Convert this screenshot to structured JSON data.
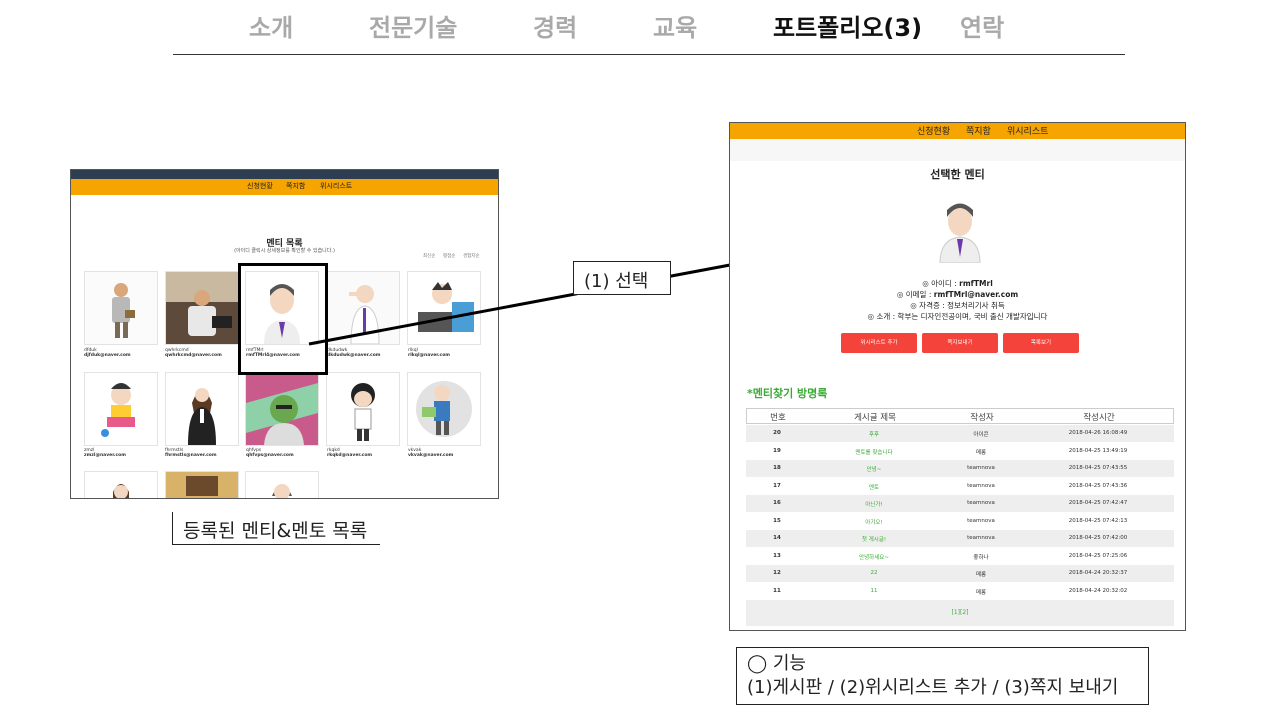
{
  "nav": {
    "items": [
      "소개",
      "전문기술",
      "경력",
      "교육",
      "포트폴리오(3)",
      "연락"
    ],
    "active_index": 4
  },
  "left_shot": {
    "menu": [
      "신청현황",
      "쪽지함",
      "위시리스트"
    ],
    "title": "멘티 목록",
    "subtitle": "(아이디 클릭시 상세정보를 확인할 수 있습니다.)",
    "sort": [
      "최신순",
      "평점순",
      "경험지순"
    ],
    "cards": [
      {
        "id": "dfduk",
        "email": "djfduk@naver.com"
      },
      {
        "id": "qwhrkcmd",
        "email": "qwhrkcmd@naver.com"
      },
      {
        "id": "rmfTMrl",
        "email": "rmfTMrl4@naver.com"
      },
      {
        "id": "dkdudwk",
        "email": "dkdudwk@naver.com"
      },
      {
        "id": "rlkql",
        "email": "rlkql@naver.com"
      },
      {
        "id": "zmzl",
        "email": "zmzl@naver.com"
      },
      {
        "id": "fhrmstls",
        "email": "fhrmstls@naver.com"
      },
      {
        "id": "qhfvps",
        "email": "qhfvps@naver.com"
      },
      {
        "id": "rkqkd",
        "email": "rkqkd@naver.com"
      },
      {
        "id": "vkvak",
        "email": "vkvak@naver.com"
      }
    ]
  },
  "left_caption": "등록된 멘티&멘토 목록",
  "annotation": "(1) 선택",
  "right_shot": {
    "menu": [
      "신청현황",
      "쪽지함",
      "위시리스트"
    ],
    "title": "선택한 멘티",
    "info": {
      "id_label": "◎ 아이디 : ",
      "id_value": "rmfTMrl",
      "email_label": "◎ 이메일 : ",
      "email_value": "rmfTMrl@naver.com",
      "cert": "◎ 자격증 : 정보처리기사 취득",
      "intro": "◎ 소개 : 학부는 디자인전공이며, 국비 출신 개발자입니다"
    },
    "buttons": [
      "위시리스트 추가",
      "쪽지보내기",
      "목록보기"
    ],
    "guestbook_title": "*멘티찾기 방명록",
    "table": {
      "headers": [
        "번호",
        "게시글 제목",
        "작성자",
        "작성시간"
      ],
      "rows": [
        {
          "no": "20",
          "title": "후후",
          "writer": "아이콘",
          "time": "2018-04-26 16:08:49"
        },
        {
          "no": "19",
          "title": "멘토를 찾습니다",
          "writer": "메롱",
          "time": "2018-04-25 13:49:19"
        },
        {
          "no": "18",
          "title": "안녕~",
          "writer": "teamnova",
          "time": "2018-04-25 07:43:55"
        },
        {
          "no": "17",
          "title": "멘토",
          "writer": "teamnova",
          "time": "2018-04-25 07:43:36"
        },
        {
          "no": "16",
          "title": "아닌가!",
          "writer": "teamnova",
          "time": "2018-04-25 07:42:47"
        },
        {
          "no": "15",
          "title": "아기오!",
          "writer": "teamnova",
          "time": "2018-04-25 07:42:13"
        },
        {
          "no": "14",
          "title": "첫 게시글!",
          "writer": "teamnova",
          "time": "2018-04-25 07:42:00"
        },
        {
          "no": "13",
          "title": "안녕하세요~",
          "writer": "좋하나",
          "time": "2018-04-25 07:25:06"
        },
        {
          "no": "12",
          "title": "22",
          "writer": "메롱",
          "time": "2018-04-24 20:32:37"
        },
        {
          "no": "11",
          "title": "11",
          "writer": "메롱",
          "time": "2018-04-24 20:32:02"
        }
      ],
      "pagination": "[1][2]"
    }
  },
  "feature_box": {
    "line1": "◯ 기능",
    "line2": "(1)게시판 / (2)위시리스트 추가 / (3)쪽지 보내기"
  },
  "colors": {
    "orange": "#f5a400",
    "red_button": "#f4433a",
    "green": "#3aaa35",
    "dark_bar": "#2c3e50"
  }
}
